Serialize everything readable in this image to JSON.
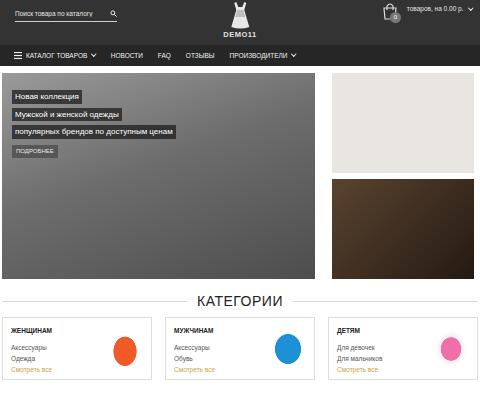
{
  "header": {
    "search": {
      "placeholder": "Поиск товара по каталогу"
    },
    "logo": "DEMO11",
    "cart": {
      "count": "0",
      "summary": "товаров, на 0.00 р."
    }
  },
  "nav": {
    "items": [
      {
        "label": "КАТАЛОГ ТОВАРОВ",
        "menu_icon": true,
        "dropdown": true
      },
      {
        "label": "НОВОСТИ",
        "menu_icon": false,
        "dropdown": false
      },
      {
        "label": "FAQ",
        "menu_icon": false,
        "dropdown": false
      },
      {
        "label": "ОТЗЫВЫ",
        "menu_icon": false,
        "dropdown": false
      },
      {
        "label": "ПРОИЗВОДИТЕЛИ",
        "menu_icon": false,
        "dropdown": true
      }
    ]
  },
  "banner": {
    "lines": [
      "Новая коллекция",
      "Мужской и женской одежды",
      "популярных брендов по доступным ценам"
    ],
    "button": "ПОДРОБНЕЕ"
  },
  "categories": {
    "title": "КАТЕГОРИИ",
    "items": [
      {
        "title": "ЖЕНЩИНАМ",
        "links": [
          "Аксессуары",
          "Одежда"
        ],
        "more": "Смотреть все"
      },
      {
        "title": "МУЖЧИНАМ",
        "links": [
          "Аксессуары",
          "Обувь"
        ],
        "more": "Смотреть все"
      },
      {
        "title": "ДЕТЯМ",
        "links": [
          "Для девочек",
          "Для мальчиков"
        ],
        "more": "Смотреть все"
      }
    ]
  }
}
